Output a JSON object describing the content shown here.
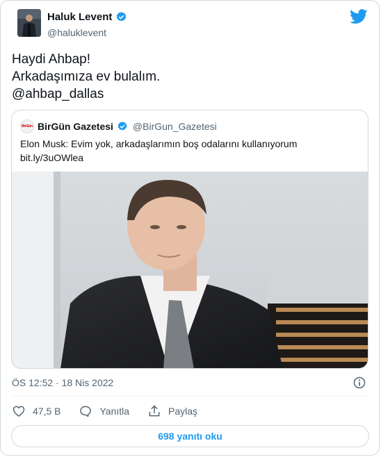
{
  "author": {
    "name": "Haluk Levent",
    "handle": "@haluklevent"
  },
  "tweet": {
    "lines": [
      "Haydi Ahbap!",
      "Arkadaşımıza ev bulalım.",
      "@ahbap_dallas"
    ]
  },
  "quoted": {
    "name": "BirGün Gazetesi",
    "handle": "@BirGun_Gazetesi",
    "text": "Elon Musk: Evim yok, arkadaşlarımın boş odalarını kullanıyorum",
    "link": "bit.ly/3uOWlea",
    "logo_text": "BirGün"
  },
  "meta": {
    "timestamp": "ÖS 12:52 · 18 Nis 2022"
  },
  "actions": {
    "likes": "47,5 B",
    "reply": "Yanıtla",
    "share": "Paylaş"
  },
  "replies_button": "698 yanıtı oku",
  "colors": {
    "accent": "#1d9bf0",
    "verified": "#1d9bf0",
    "secondary_text": "#536471",
    "border": "#cfd9de"
  },
  "icons": [
    "twitter-bird-icon",
    "verified-badge-icon",
    "info-icon",
    "heart-icon",
    "reply-icon",
    "share-icon"
  ]
}
